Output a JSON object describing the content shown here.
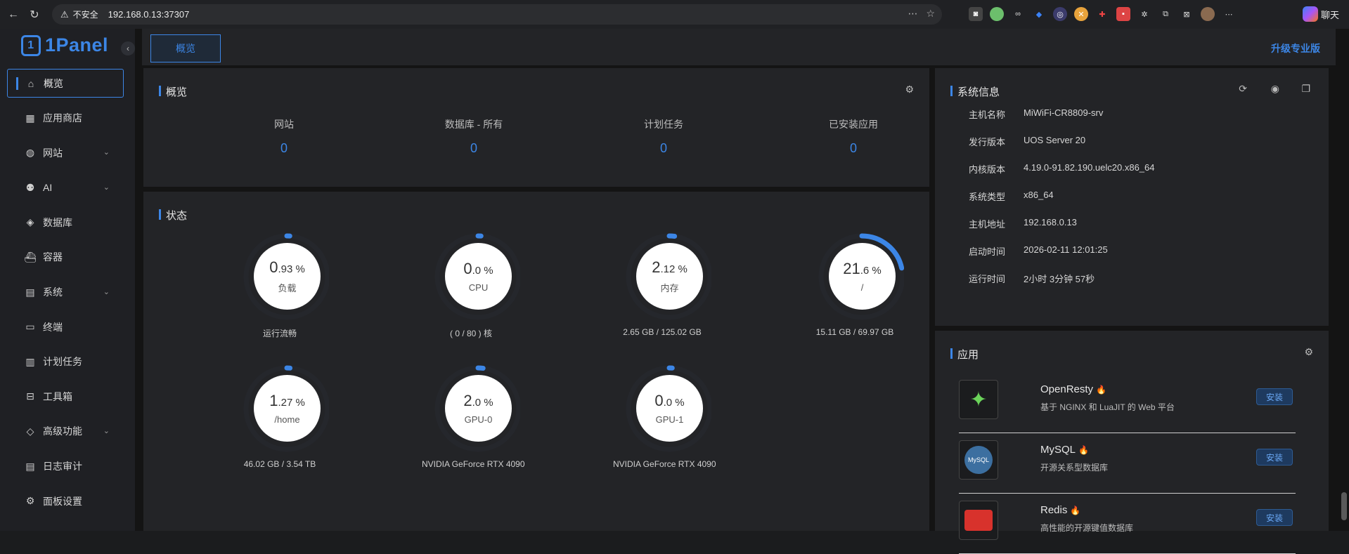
{
  "browser": {
    "security_label": "不安全",
    "url": "192.168.0.13:37307",
    "chat_label": "聊天"
  },
  "sidebar": {
    "brand": "1Panel",
    "items": [
      {
        "label": "概览",
        "icon": "home-icon",
        "expandable": false,
        "active": true
      },
      {
        "label": "应用商店",
        "icon": "grid-icon",
        "expandable": false,
        "active": false
      },
      {
        "label": "网站",
        "icon": "globe-icon",
        "expandable": true,
        "active": false
      },
      {
        "label": "AI",
        "icon": "robot-icon",
        "expandable": true,
        "active": false
      },
      {
        "label": "数据库",
        "icon": "layers-icon",
        "expandable": false,
        "active": false
      },
      {
        "label": "容器",
        "icon": "whale-icon",
        "expandable": false,
        "active": false
      },
      {
        "label": "系统",
        "icon": "document-icon",
        "expandable": true,
        "active": false
      },
      {
        "label": "终端",
        "icon": "terminal-icon",
        "expandable": false,
        "active": false
      },
      {
        "label": "计划任务",
        "icon": "calendar-icon",
        "expandable": false,
        "active": false
      },
      {
        "label": "工具箱",
        "icon": "toolbox-icon",
        "expandable": false,
        "active": false
      },
      {
        "label": "高级功能",
        "icon": "diamond-icon",
        "expandable": true,
        "active": false
      },
      {
        "label": "日志审计",
        "icon": "log-icon",
        "expandable": false,
        "active": false
      },
      {
        "label": "面板设置",
        "icon": "settings-icon",
        "expandable": false,
        "active": false
      }
    ]
  },
  "topbar": {
    "tab": "概览",
    "upgrade": "升级专业版"
  },
  "overview": {
    "title": "概览",
    "stats": [
      {
        "label": "网站",
        "value": "0"
      },
      {
        "label": "数据库 - 所有",
        "value": "0"
      },
      {
        "label": "计划任务",
        "value": "0"
      },
      {
        "label": "已安装应用",
        "value": "0"
      }
    ]
  },
  "status": {
    "title": "状态",
    "gauges": [
      {
        "int": "0",
        "dec": ".93 %",
        "name": "负载",
        "sub": "运行流畅",
        "percent": 0.93
      },
      {
        "int": "0",
        "dec": ".0 %",
        "name": "CPU",
        "sub": "( 0 / 80 ) 核",
        "percent": 0.0
      },
      {
        "int": "2",
        "dec": ".12 %",
        "name": "内存",
        "sub": "2.65 GB / 125.02 GB",
        "percent": 2.12
      },
      {
        "int": "21",
        "dec": ".6 %",
        "name": "/",
        "sub": "15.11 GB / 69.97 GB",
        "percent": 21.6
      },
      {
        "int": "1",
        "dec": ".27 %",
        "name": "/home",
        "sub": "46.02 GB / 3.54 TB",
        "percent": 1.27
      },
      {
        "int": "2",
        "dec": ".0 %",
        "name": "GPU-0",
        "sub": "NVIDIA GeForce RTX 4090",
        "percent": 2.0
      },
      {
        "int": "0",
        "dec": ".0 %",
        "name": "GPU-1",
        "sub": "NVIDIA GeForce RTX 4090",
        "percent": 0.0
      }
    ]
  },
  "sysinfo": {
    "title": "系统信息",
    "rows": [
      {
        "k": "主机名称",
        "v": "MiWiFi-CR8809-srv"
      },
      {
        "k": "发行版本",
        "v": "UOS Server 20"
      },
      {
        "k": "内核版本",
        "v": "4.19.0-91.82.190.uelc20.x86_64"
      },
      {
        "k": "系统类型",
        "v": "x86_64"
      },
      {
        "k": "主机地址",
        "v": "192.168.0.13"
      },
      {
        "k": "启动时间",
        "v": "2026-02-11 12:01:25"
      },
      {
        "k": "运行时间",
        "v": "2小时 3分钟 57秒"
      }
    ]
  },
  "apps": {
    "title": "应用",
    "install_label": "安装",
    "items": [
      {
        "name": "OpenResty",
        "desc": "基于 NGINX 和 LuaJIT 的 Web 平台",
        "icon": "openresty-logo-icon"
      },
      {
        "name": "MySQL",
        "desc": "开源关系型数据库",
        "icon": "mysql-logo-icon",
        "logo_text": "MySQL"
      },
      {
        "name": "Redis",
        "desc": "高性能的开源键值数据库",
        "icon": "redis-logo-icon"
      }
    ]
  },
  "colors": {
    "accent": "#3c86e6",
    "background": "#141414",
    "card": "#232427"
  }
}
